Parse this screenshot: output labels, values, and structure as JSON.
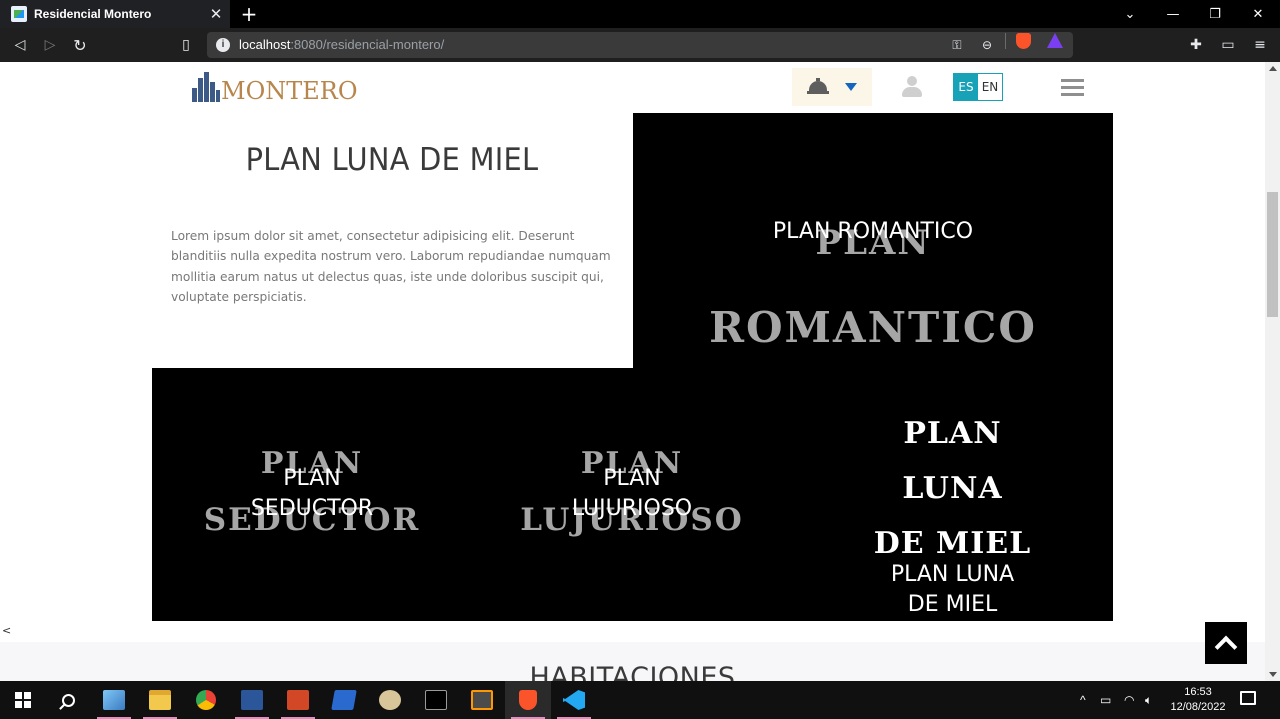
{
  "browser": {
    "tab_title": "Residencial Montero",
    "tab_close": "✕",
    "new_tab": "+",
    "url_host": "localhost",
    "url_rest": ":8080/residencial-montero/",
    "window_controls": {
      "minimize": "—",
      "restore": "❐",
      "close": "✕",
      "chevron": "⌄"
    }
  },
  "header": {
    "logo_text": "MONTERO",
    "lang_es": "ES",
    "lang_en": "EN",
    "colors": {
      "logo_gold": "#b8864d",
      "logo_blue": "#3c5a85",
      "lang_accent": "#17a2b8",
      "caret_blue": "#1565c0"
    }
  },
  "intro": {
    "title": "PLAN LUNA DE MIEL",
    "text": "Lorem ipsum dolor sit amet, consectetur adipisicing elit. Deserunt blanditiis nulla expedita nostrum vero. Laborum repudiandae numquam mollitia earum natus ut delectus quas, iste unde doloribus suscipit qui, voluptate perspiciatis."
  },
  "plans": {
    "romantico": {
      "label": "PLAN ROMANTICO",
      "bg_line1": "PLAN",
      "bg_line2": "ROMANTICO"
    },
    "seductor": {
      "label_line1": "PLAN",
      "label_line2": "SEDUCTOR",
      "bg_line1": "PLAN",
      "bg_line2": "SEDUCTOR"
    },
    "lujurioso": {
      "label_line1": "PLAN",
      "label_line2": "LUJURIOSO",
      "bg_line1": "PLAN",
      "bg_line2": "LUJURIOSO"
    },
    "luna_de_miel": {
      "featured_line1": "PLAN",
      "featured_line2": "LUNA",
      "featured_line3": "DE MIEL",
      "label_line1": "PLAN LUNA",
      "label_line2": "DE MIEL"
    }
  },
  "section": {
    "title": "HABITACIONES",
    "left_caret": "<"
  },
  "taskbar": {
    "time": "16:53",
    "date": "12/08/2022",
    "tray_chevron": "^"
  }
}
